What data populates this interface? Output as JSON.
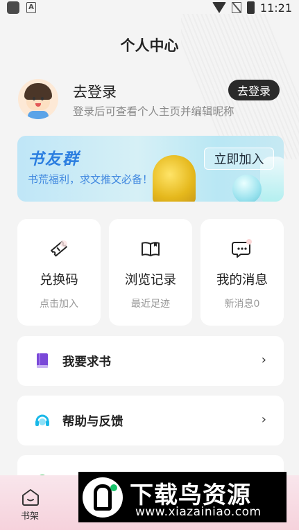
{
  "status_bar": {
    "time": "11:21",
    "a_badge": "A"
  },
  "page": {
    "title": "个人中心"
  },
  "user": {
    "name": "去登录",
    "subtitle": "登录后可查看个人主页并编辑昵称",
    "login_button": "去登录"
  },
  "banner": {
    "title": "书友群",
    "subtitle": "书荒福利，求文推文必备！",
    "join_button": "立即加入"
  },
  "cards": [
    {
      "label": "兑换码",
      "sub": "点击加入",
      "icon": "ticket-icon"
    },
    {
      "label": "浏览记录",
      "sub": "最近足迹",
      "icon": "book-icon"
    },
    {
      "label": "我的消息",
      "sub": "新消息0",
      "icon": "message-icon"
    }
  ],
  "menu": [
    {
      "label": "我要求书",
      "icon": "book-request-icon",
      "arrow": "›"
    },
    {
      "label": "帮助与反馈",
      "icon": "headset-icon",
      "arrow": "›"
    },
    {
      "label": "",
      "icon": "settings-icon"
    }
  ],
  "bottom_nav": {
    "home_label": "书架"
  },
  "watermark": {
    "title": "下载鸟资源",
    "url": "www.xiazainiao.com"
  },
  "colors": {
    "accent_blue": "#2b7ee0",
    "button_dark": "#2a2a2a",
    "purple": "#7a48d8",
    "cyan": "#19b8e8"
  }
}
